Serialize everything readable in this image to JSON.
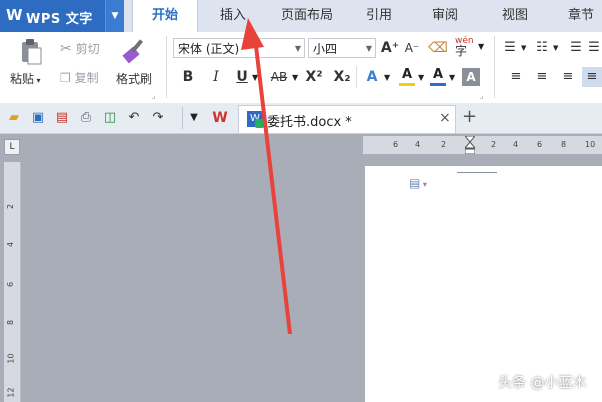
{
  "app": {
    "name": "WPS 文字",
    "logo_letter": "W"
  },
  "menu_tabs": [
    "开始",
    "插入",
    "页面布局",
    "引用",
    "审阅",
    "视图",
    "章节"
  ],
  "ribbon": {
    "paste_label": "粘贴",
    "cut_label": "剪切",
    "copy_label": "复制",
    "format_painter_label": "格式刷",
    "font_name": "宋体 (正文)",
    "font_size": "小四",
    "bold": "B",
    "italic": "I",
    "underline": "U",
    "strikethrough": "AB",
    "superscript": "X²",
    "subscript": "X₂",
    "grow_font": "A⁺",
    "shrink_font": "A⁻",
    "pinyin": "wén",
    "font_color": "A",
    "highlight": "A"
  },
  "document_tab": {
    "title": "委托书.docx *",
    "close": "×",
    "new_tab": "+"
  },
  "ruler": {
    "horizontal_ticks": [
      "6",
      "4",
      "2",
      "2",
      "4",
      "6",
      "8",
      "10"
    ],
    "vertical_ticks": [
      "2",
      "4",
      "6",
      "8",
      "10",
      "12"
    ],
    "corner": "L"
  },
  "watermark": "头条 @小蓝木",
  "colors": {
    "app_button": "#2d6cc0",
    "arrow": "#e8423a",
    "workspace": "#a9adb7"
  }
}
